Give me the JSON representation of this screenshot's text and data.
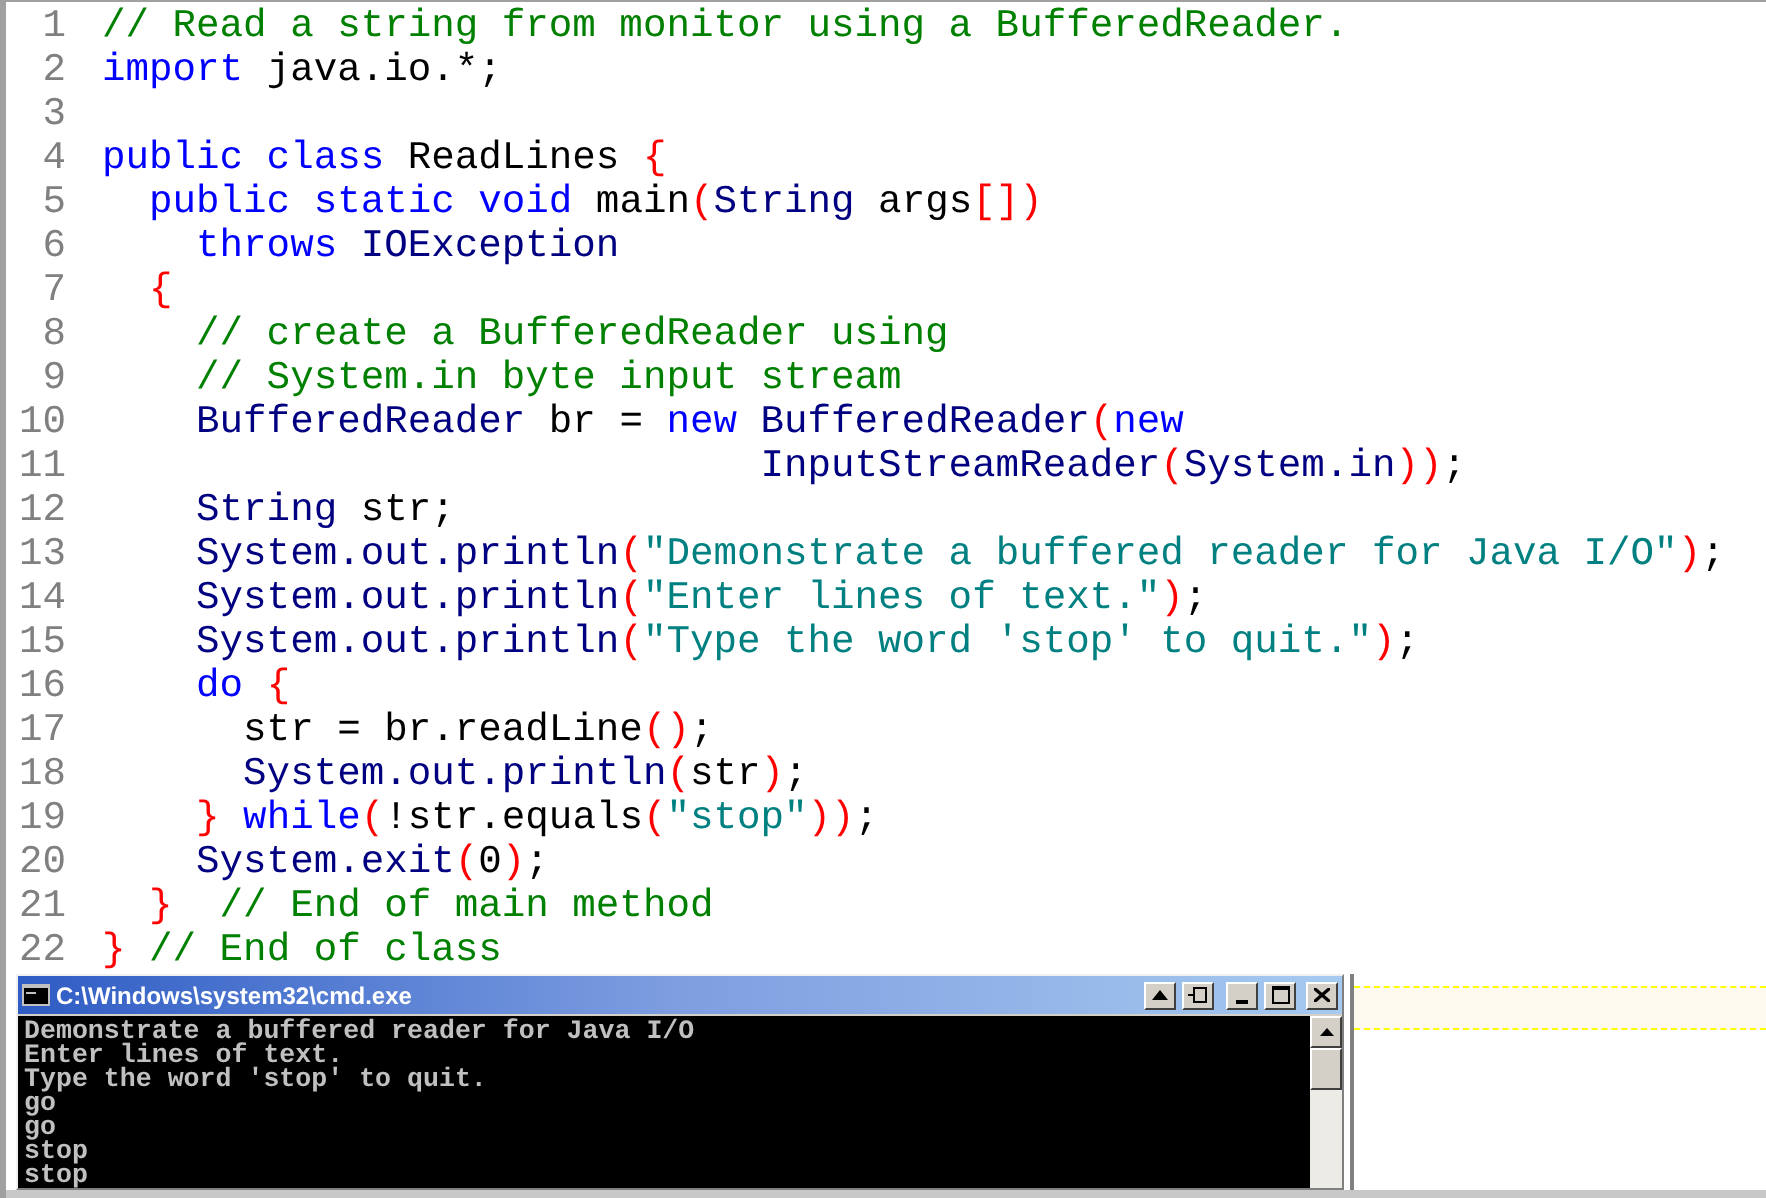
{
  "editor": {
    "lines": [
      {
        "number": "1",
        "tokens": [
          {
            "kind": "comment",
            "text": "// Read a string from monitor using a BufferedReader."
          }
        ]
      },
      {
        "number": "2",
        "tokens": [
          {
            "kind": "keyword",
            "text": "import"
          },
          {
            "kind": "plain",
            "text": " java.io.*;"
          }
        ]
      },
      {
        "number": "3"
      },
      {
        "number": "4",
        "tokens": [
          {
            "kind": "keyword",
            "text": "public class"
          },
          {
            "kind": "plain",
            "text": " ReadLines "
          },
          {
            "kind": "bracket",
            "text": "{"
          }
        ]
      },
      {
        "number": "5",
        "tokens": [
          {
            "kind": "keyword",
            "text": "  public static void"
          },
          {
            "kind": "plain",
            "text": " main"
          },
          {
            "kind": "bracket",
            "text": "("
          },
          {
            "kind": "type",
            "text": "String"
          },
          {
            "kind": "plain",
            "text": " args"
          },
          {
            "kind": "bracket",
            "text": "[])"
          }
        ]
      },
      {
        "number": "6",
        "tokens": [
          {
            "kind": "keyword",
            "text": "    throws"
          },
          {
            "kind": "type",
            "text": " IOException"
          }
        ]
      },
      {
        "number": "7",
        "tokens": [
          {
            "kind": "bracket",
            "text": "  {"
          }
        ]
      },
      {
        "number": "8",
        "tokens": [
          {
            "kind": "comment",
            "text": "    // create a BufferedReader using"
          }
        ]
      },
      {
        "number": "9",
        "tokens": [
          {
            "kind": "comment",
            "text": "    // System.in byte input stream"
          }
        ]
      },
      {
        "number": "10",
        "tokens": [
          {
            "kind": "type",
            "text": "    BufferedReader"
          },
          {
            "kind": "plain",
            "text": " br = "
          },
          {
            "kind": "keyword",
            "text": "new"
          },
          {
            "kind": "type",
            "text": " BufferedReader"
          },
          {
            "kind": "bracket",
            "text": "("
          },
          {
            "kind": "keyword",
            "text": "new"
          }
        ]
      },
      {
        "number": "11",
        "tokens": [
          {
            "kind": "type",
            "text": "                            InputStreamReader"
          },
          {
            "kind": "bracket",
            "text": "("
          },
          {
            "kind": "type",
            "text": "System.in"
          },
          {
            "kind": "bracket",
            "text": "))"
          },
          {
            "kind": "plain",
            "text": ";"
          }
        ]
      },
      {
        "number": "12",
        "tokens": [
          {
            "kind": "type",
            "text": "    String"
          },
          {
            "kind": "plain",
            "text": " str;"
          }
        ]
      },
      {
        "number": "13",
        "tokens": [
          {
            "kind": "type",
            "text": "    System.out.println"
          },
          {
            "kind": "bracket",
            "text": "("
          },
          {
            "kind": "string",
            "text": "\"Demonstrate a buffered reader for Java I/O\""
          },
          {
            "kind": "bracket",
            "text": ")"
          },
          {
            "kind": "plain",
            "text": ";"
          }
        ]
      },
      {
        "number": "14",
        "tokens": [
          {
            "kind": "type",
            "text": "    System.out.println"
          },
          {
            "kind": "bracket",
            "text": "("
          },
          {
            "kind": "string",
            "text": "\"Enter lines of text.\""
          },
          {
            "kind": "bracket",
            "text": ")"
          },
          {
            "kind": "plain",
            "text": ";"
          }
        ]
      },
      {
        "number": "15",
        "tokens": [
          {
            "kind": "type",
            "text": "    System.out.println"
          },
          {
            "kind": "bracket",
            "text": "("
          },
          {
            "kind": "string",
            "text": "\"Type the word 'stop' to quit.\""
          },
          {
            "kind": "bracket",
            "text": ")"
          },
          {
            "kind": "plain",
            "text": ";"
          }
        ]
      },
      {
        "number": "16",
        "tokens": [
          {
            "kind": "keyword",
            "text": "    do"
          },
          {
            "kind": "bracket",
            "text": " {"
          }
        ]
      },
      {
        "number": "17",
        "tokens": [
          {
            "kind": "plain",
            "text": "      str = br.readLine"
          },
          {
            "kind": "bracket",
            "text": "()"
          },
          {
            "kind": "plain",
            "text": ";"
          }
        ]
      },
      {
        "number": "18",
        "tokens": [
          {
            "kind": "type",
            "text": "      System.out.println"
          },
          {
            "kind": "bracket",
            "text": "("
          },
          {
            "kind": "plain",
            "text": "str"
          },
          {
            "kind": "bracket",
            "text": ")"
          },
          {
            "kind": "plain",
            "text": ";"
          }
        ]
      },
      {
        "number": "19",
        "tokens": [
          {
            "kind": "bracket",
            "text": "    }"
          },
          {
            "kind": "keyword",
            "text": " while"
          },
          {
            "kind": "bracket",
            "text": "("
          },
          {
            "kind": "plain",
            "text": "!str.equals"
          },
          {
            "kind": "bracket",
            "text": "("
          },
          {
            "kind": "string",
            "text": "\"stop\""
          },
          {
            "kind": "bracket",
            "text": "))"
          },
          {
            "kind": "plain",
            "text": ";"
          }
        ]
      },
      {
        "number": "20",
        "tokens": [
          {
            "kind": "type",
            "text": "    System.exit"
          },
          {
            "kind": "bracket",
            "text": "("
          },
          {
            "kind": "plain",
            "text": "0"
          },
          {
            "kind": "bracket",
            "text": ")"
          },
          {
            "kind": "plain",
            "text": ";"
          }
        ]
      },
      {
        "number": "21",
        "tokens": [
          {
            "kind": "bracket",
            "text": "  }"
          },
          {
            "kind": "comment",
            "text": "  // End of main method"
          }
        ]
      },
      {
        "number": "22",
        "tokens": [
          {
            "kind": "bracket",
            "text": "}"
          },
          {
            "kind": "comment",
            "text": " // End of class"
          }
        ]
      }
    ]
  },
  "console": {
    "title": "C:\\Windows\\system32\\cmd.exe",
    "lines": [
      "Demonstrate a buffered reader for Java I/O",
      "Enter lines of text.",
      "Type the word 'stop' to quit.",
      "go",
      "go",
      "stop",
      "stop"
    ]
  }
}
